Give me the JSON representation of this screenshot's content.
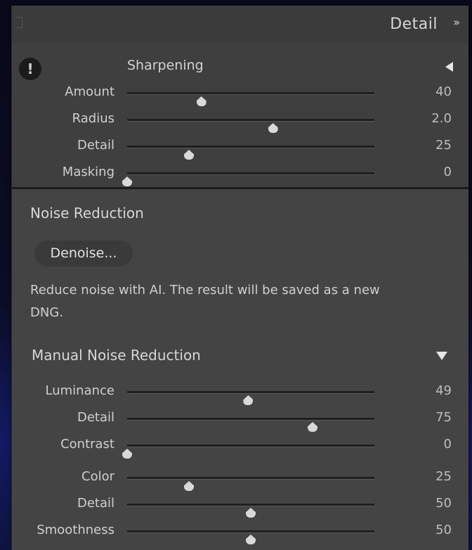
{
  "header": {
    "title": "Detail",
    "collapse_glyph": "»"
  },
  "sharpening": {
    "title": "Sharpening",
    "warning_glyph": "!",
    "sliders": [
      {
        "label": "Amount",
        "value": "40",
        "fraction": 0.3
      },
      {
        "label": "Radius",
        "value": "2.0",
        "fraction": 0.59
      },
      {
        "label": "Detail",
        "value": "25",
        "fraction": 0.25
      },
      {
        "label": "Masking",
        "value": "0",
        "fraction": 0.0
      }
    ]
  },
  "noise_reduction": {
    "title": "Noise Reduction",
    "denoise_label": "Denoise...",
    "description": "Reduce noise with AI. The result will be saved as a new DNG.",
    "manual_title": "Manual Noise Reduction",
    "luminance_sliders": [
      {
        "label": "Luminance",
        "value": "49",
        "fraction": 0.49
      },
      {
        "label": "Detail",
        "value": "75",
        "fraction": 0.75
      },
      {
        "label": "Contrast",
        "value": "0",
        "fraction": 0.0
      }
    ],
    "color_sliders": [
      {
        "label": "Color",
        "value": "25",
        "fraction": 0.25
      },
      {
        "label": "Detail",
        "value": "50",
        "fraction": 0.5
      },
      {
        "label": "Smoothness",
        "value": "50",
        "fraction": 0.5
      }
    ]
  }
}
